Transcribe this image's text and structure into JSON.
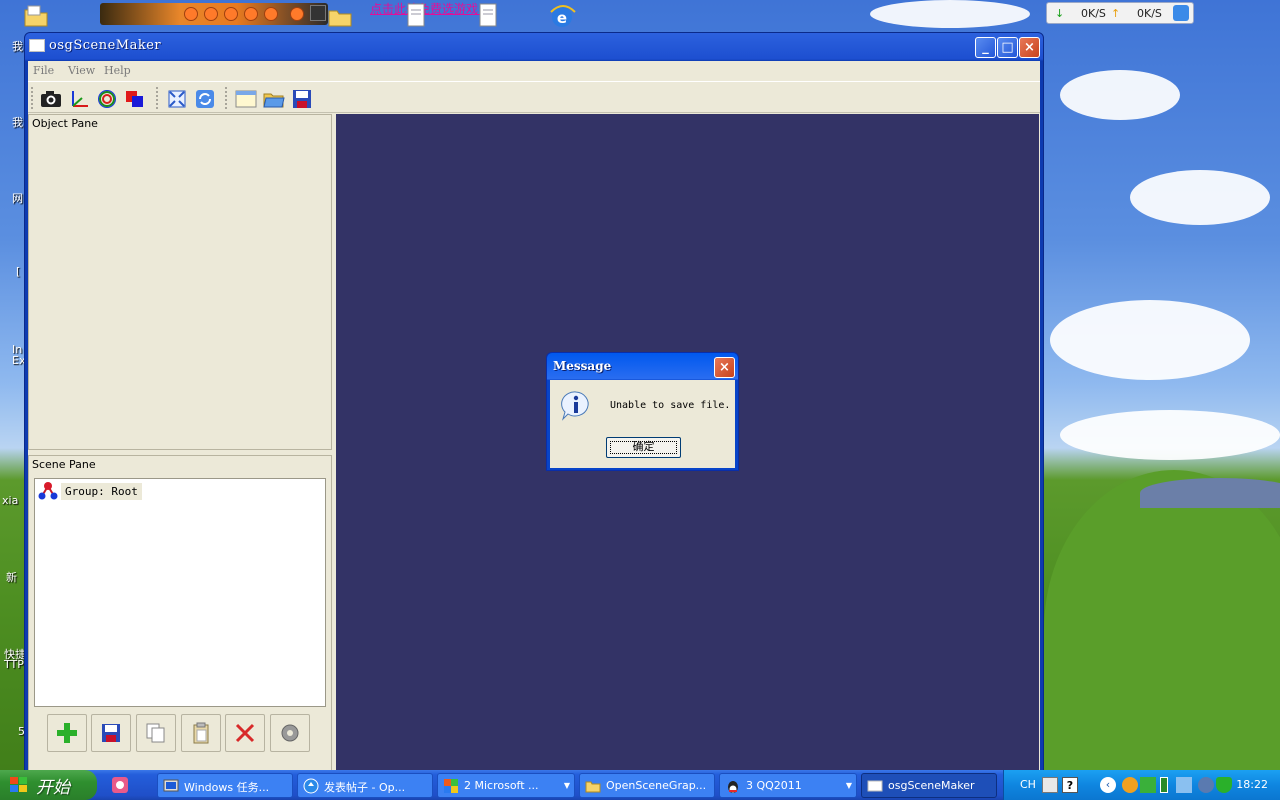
{
  "desktop": {
    "promo_text": "点击此处免费选游戏!",
    "left_fragments": [
      "我",
      "我",
      "网",
      "[",
      "In",
      "Ex",
      "xia",
      "新",
      "快捷",
      "TTP",
      "5"
    ],
    "netspeed": {
      "down": "0K/S",
      "up": "0K/S"
    }
  },
  "window": {
    "title": "osgSceneMaker",
    "menu": [
      "File",
      "View",
      "Help"
    ],
    "toolbar_groups": [
      [
        "camera-icon",
        "axes-icon",
        "orbit-icon",
        "overlap-icon"
      ],
      [
        "fit-view-icon",
        "refresh-icon"
      ],
      [
        "new-window-icon",
        "open-folder-icon",
        "save-disk-icon"
      ]
    ],
    "object_pane": {
      "title": "Object Pane"
    },
    "scene_pane": {
      "title": "Scene Pane",
      "tree": [
        {
          "label": "Group: Root",
          "icon": "group-node-icon"
        }
      ],
      "buttons": [
        "add-icon",
        "save-icon",
        "copy-icon",
        "paste-icon",
        "delete-icon",
        "settings-icon"
      ]
    },
    "viewport_color": "#333366"
  },
  "dialog": {
    "title": "Message",
    "message": "Unable to save file.",
    "ok_label": "确定"
  },
  "taskbar": {
    "start_label": "开始",
    "tasks": [
      {
        "label": "Windows 任务...",
        "icon": "task-manager-icon",
        "caret": false,
        "active": false
      },
      {
        "label": "发表帖子 - Op...",
        "icon": "browser-icon",
        "caret": false,
        "active": false
      },
      {
        "label": "2 Microsoft ...",
        "icon": "office-icon",
        "caret": true,
        "active": false
      },
      {
        "label": "OpenSceneGrap...",
        "icon": "folder-icon",
        "caret": false,
        "active": false
      },
      {
        "label": "3 QQ2011",
        "icon": "qq-icon",
        "caret": true,
        "active": false
      },
      {
        "label": "osgSceneMaker",
        "icon": "app-window-icon",
        "caret": false,
        "active": true
      }
    ],
    "tray": {
      "lang": "CH",
      "time": "18:22"
    }
  }
}
